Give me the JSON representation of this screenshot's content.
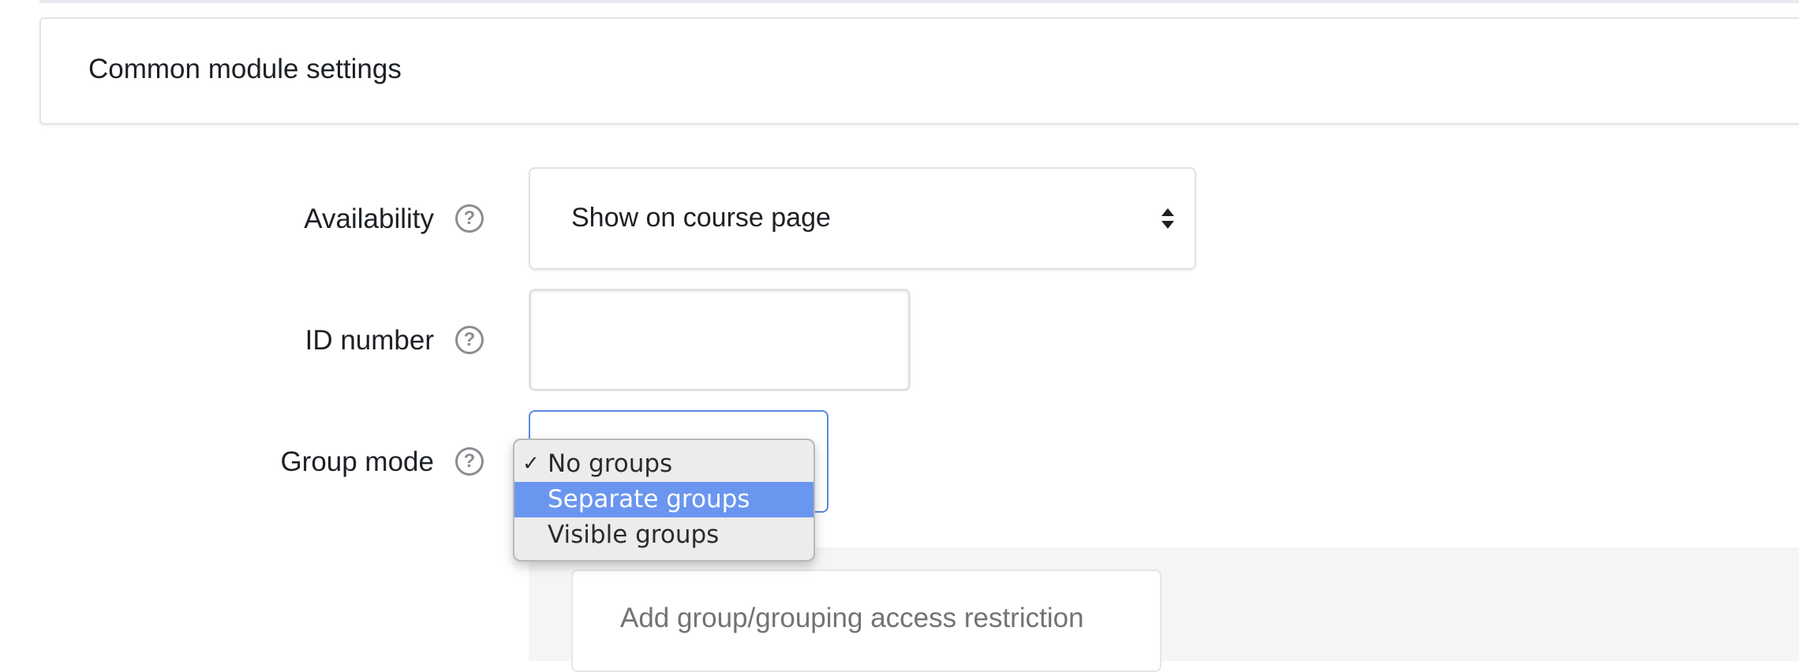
{
  "section": {
    "title": "Common module settings"
  },
  "fields": {
    "availability": {
      "label": "Availability",
      "value": "Show on course page"
    },
    "id_number": {
      "label": "ID number",
      "value": ""
    },
    "group_mode": {
      "label": "Group mode",
      "options": [
        {
          "label": "No groups",
          "checked": true,
          "highlighted": false
        },
        {
          "label": "Separate groups",
          "checked": false,
          "highlighted": true
        },
        {
          "label": "Visible groups",
          "checked": false,
          "highlighted": false
        }
      ],
      "check_mark": "✓"
    }
  },
  "help_icon_glyph": "?",
  "restriction": {
    "button_label": "Add group/grouping access restriction"
  },
  "colors": {
    "highlight": "#6a96f0",
    "focus_border": "#5a88e0"
  }
}
